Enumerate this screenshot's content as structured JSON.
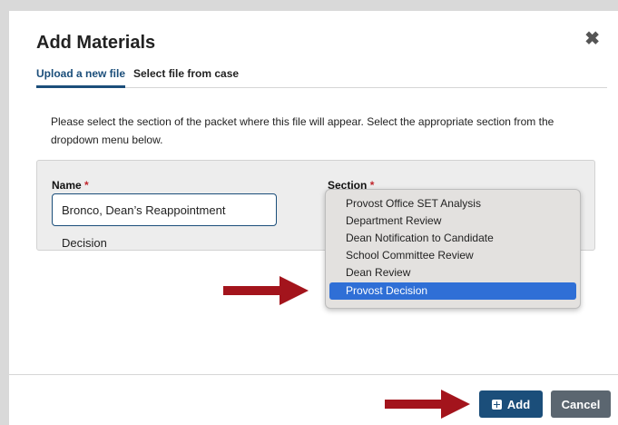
{
  "dialog": {
    "title": "Add Materials",
    "close_icon": "close-icon"
  },
  "tabs": [
    {
      "label": "Upload a new file",
      "active": true
    },
    {
      "label": "Select file from case",
      "active": false
    }
  ],
  "instructions": "Please select the section of the packet where this file will appear. Select the appropriate section from the dropdown menu below.",
  "form": {
    "name_label": "Name",
    "section_label": "Section",
    "required_mark": "*",
    "name_value": "Bronco, Dean’s Reappointment Decision"
  },
  "dropdown": {
    "options": [
      "Provost Office SET Analysis",
      "Department Review",
      "Dean Notification to Candidate",
      "School Committee Review",
      "Dean Review",
      "Provost Decision"
    ],
    "selected": "Provost Decision"
  },
  "footer": {
    "add_label": "Add",
    "cancel_label": "Cancel"
  },
  "colors": {
    "primary": "#1b4e7a",
    "required": "#c0262d",
    "selected_option": "#2f6fd6",
    "annotation_arrow": "#a3141c",
    "cancel": "#5b6670"
  }
}
